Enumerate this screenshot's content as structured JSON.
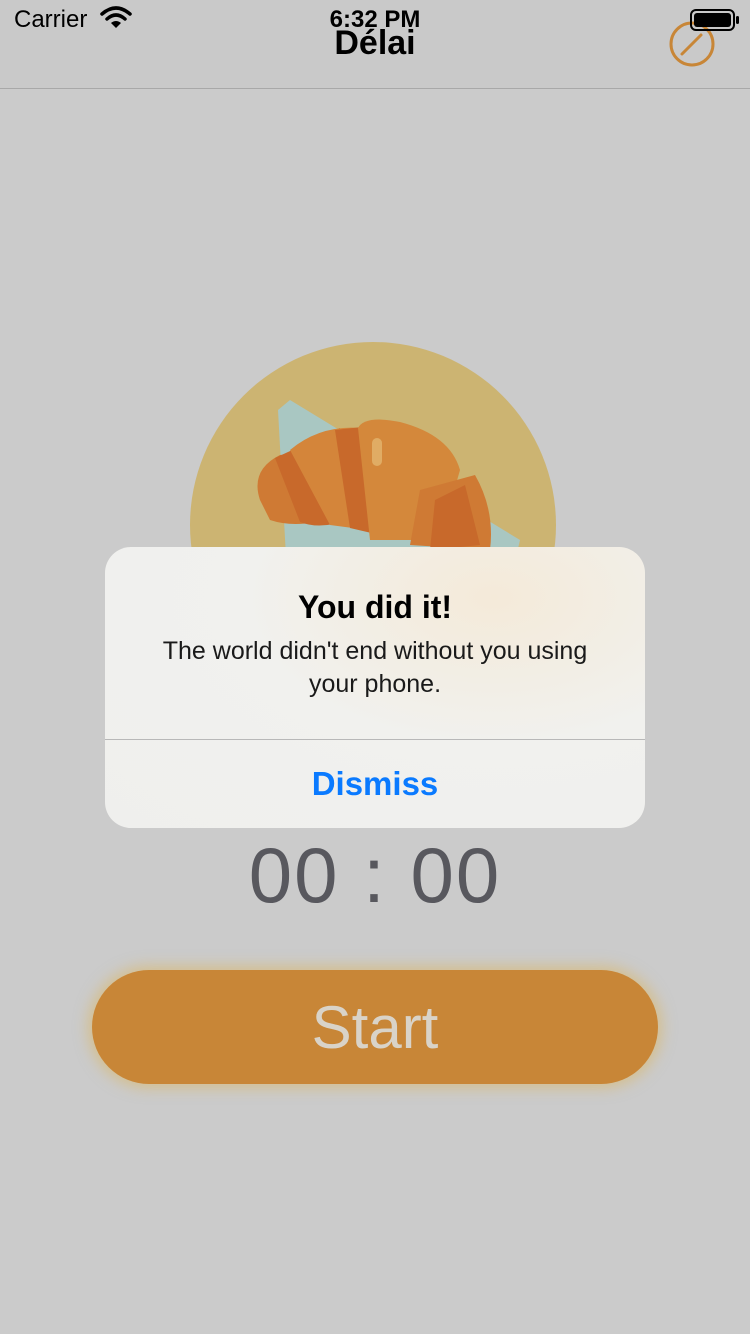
{
  "status_bar": {
    "carrier": "Carrier",
    "time": "6:32 PM"
  },
  "nav": {
    "title": "Délai",
    "right_icon": "compass-icon"
  },
  "timer": {
    "display": "00 : 00"
  },
  "start_button": {
    "label": "Start"
  },
  "alert": {
    "title": "You did it!",
    "message": "The world didn't end without you using your phone.",
    "dismiss_label": "Dismiss"
  },
  "colors": {
    "background": "#cbcbcb",
    "accent_orange": "#c88637",
    "link_blue": "#0a7aff",
    "hero_circle": "#ccb472"
  }
}
